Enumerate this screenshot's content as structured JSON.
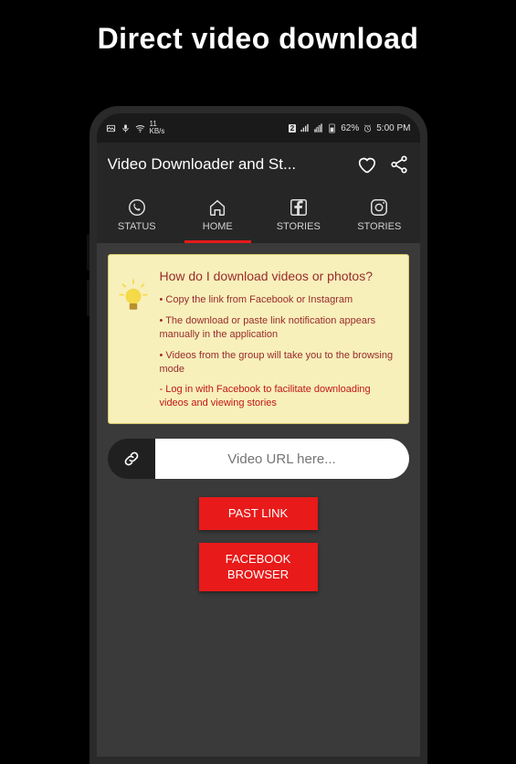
{
  "heading": "Direct video download",
  "statusbar": {
    "kbps_top": "11",
    "kbps_bottom": "KB/s",
    "sim": "2",
    "battery": "62%",
    "time": "5:00 PM"
  },
  "appbar": {
    "title": "Video Downloader and St..."
  },
  "tabs": [
    {
      "label": "STATUS"
    },
    {
      "label": "HOME"
    },
    {
      "label": "STORIES"
    },
    {
      "label": "STORIES"
    }
  ],
  "info": {
    "title": "How do I download videos or photos?",
    "items": [
      "• Copy the link from Facebook or Instagram",
      "• The download or paste link notification appears manually in the application",
      "• Videos from the group will take you to the browsing mode"
    ],
    "warn": "- Log in with Facebook to facilitate downloading videos and viewing stories"
  },
  "url": {
    "placeholder": "Video URL here..."
  },
  "buttons": {
    "paste": "PAST LINK",
    "browser": "FACEBOOK BROWSER"
  }
}
